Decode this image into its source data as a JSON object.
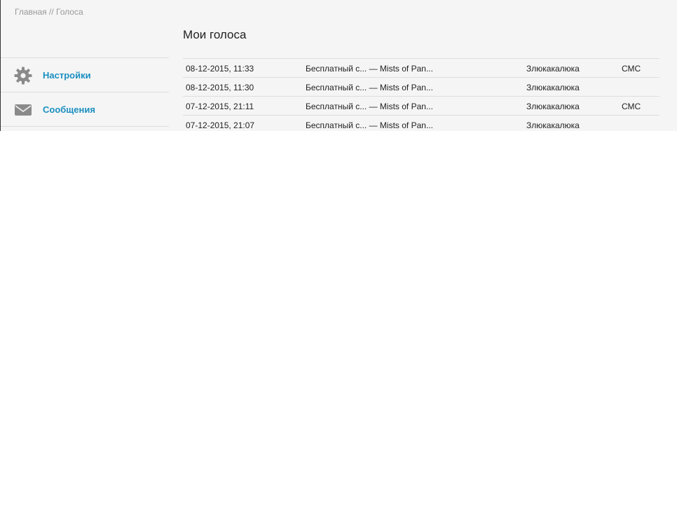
{
  "breadcrumb": {
    "home": "Главная",
    "separator": "//",
    "current": "Голоса"
  },
  "sidebar": {
    "items": [
      {
        "label": "Настройки",
        "icon": "gear-icon"
      },
      {
        "label": "Сообщения",
        "icon": "envelope-icon"
      }
    ]
  },
  "main": {
    "title": "Мои голоса",
    "votes": [
      {
        "date": "08-12-2015, 11:33",
        "item": "Бесплатный с... — Mists of Pan...",
        "user": "Злюкакалюка",
        "type": "СМС"
      },
      {
        "date": "08-12-2015, 11:30",
        "item": "Бесплатный с... — Mists of Pan...",
        "user": "Злюкакалюка",
        "type": ""
      },
      {
        "date": "07-12-2015, 21:11",
        "item": "Бесплатный с... — Mists of Pan...",
        "user": "Злюкакалюка",
        "type": "СМС"
      },
      {
        "date": "07-12-2015, 21:07",
        "item": "Бесплатный с... — Mists of Pan...",
        "user": "Злюкакалюка",
        "type": ""
      }
    ]
  },
  "colors": {
    "accent": "#1a8fc0",
    "panel_bg": "#f5f5f5",
    "divider": "#dddddd",
    "icon_gray": "#8a8a8a"
  }
}
